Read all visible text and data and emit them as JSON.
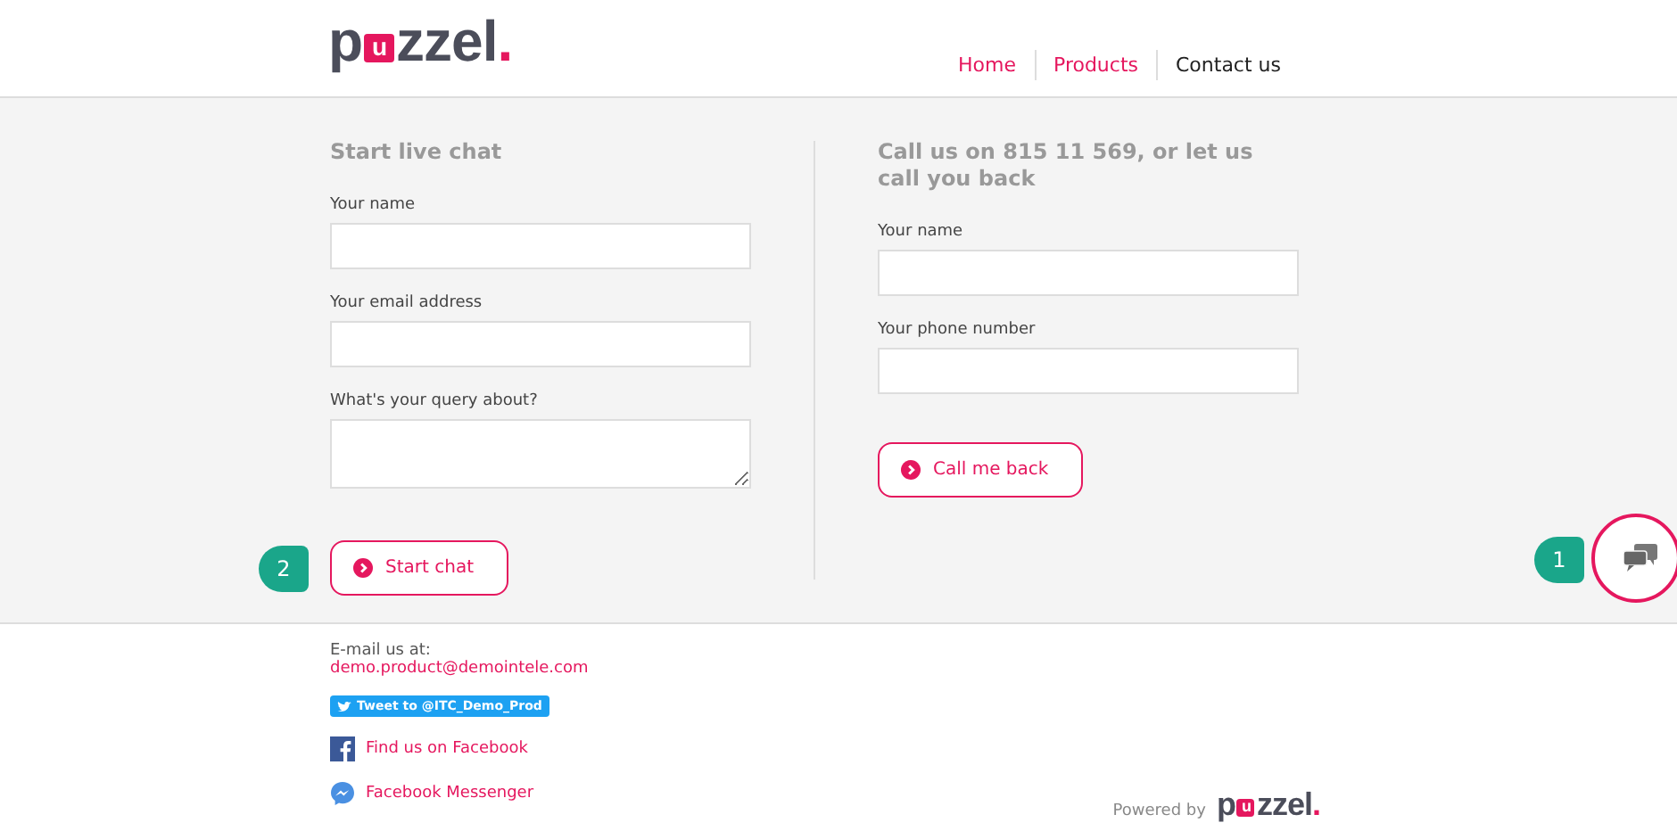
{
  "header": {
    "logo": "puzzel.",
    "nav": [
      {
        "label": "Home",
        "selected": false
      },
      {
        "label": "Products",
        "selected": false
      },
      {
        "label": "Contact us",
        "selected": true
      }
    ]
  },
  "chat_form": {
    "title": "Start live chat",
    "fields": [
      {
        "label": "Your name",
        "kind": "input"
      },
      {
        "label": "Your email address",
        "kind": "input"
      },
      {
        "label": "What's your query about?",
        "kind": "textarea"
      }
    ],
    "button": "Start chat",
    "callout": "2"
  },
  "callback_form": {
    "title": "Call us on 815 11 569, or let us call you back",
    "fields": [
      {
        "label": "Your name",
        "kind": "input"
      },
      {
        "label": "Your phone number",
        "kind": "input"
      }
    ],
    "button": "Call me back"
  },
  "chat_launcher": {
    "callout": "1"
  },
  "footer": {
    "email_label": "E-mail us at:",
    "email": "demo.product@demointele.com",
    "tweet": "Tweet to @ITC_Demo_Prod",
    "links": [
      {
        "label": "Find us on Facebook",
        "kind": "facebook"
      },
      {
        "label": "Facebook Messenger",
        "kind": "messenger"
      }
    ],
    "powered_by": "Powered by",
    "logo": "puzzel."
  }
}
